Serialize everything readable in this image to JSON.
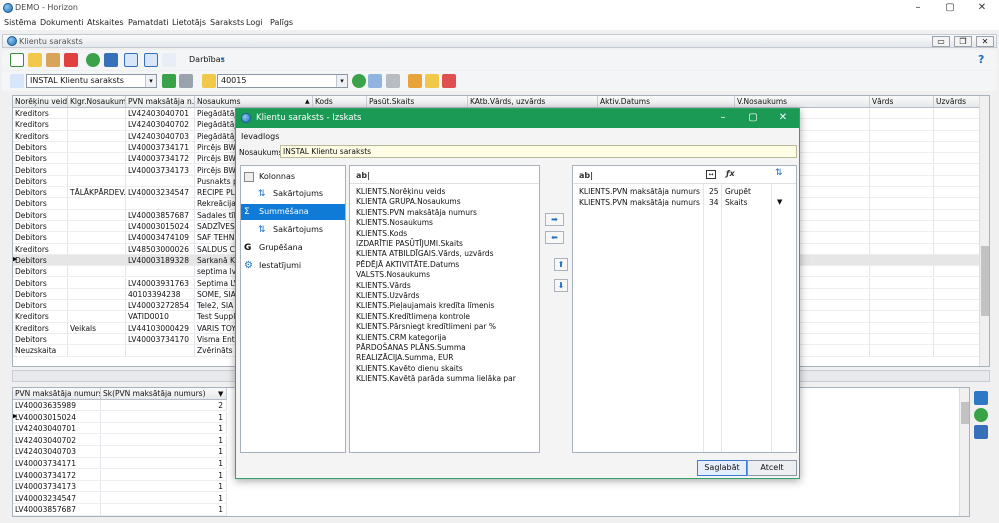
{
  "window": {
    "title": "DEMO - Horizon",
    "controls": [
      "–",
      "▢",
      "✕"
    ]
  },
  "menu": [
    "Sistēma",
    "Dokumenti",
    "Atskaites",
    "Pamatdati",
    "Lietotājs",
    "Saraksts",
    "Logi",
    "Palīgs"
  ],
  "subwindow": {
    "title": "Klientu saraksts",
    "controls": [
      "▭",
      "❐",
      "✕"
    ]
  },
  "toolbar": {
    "darbibas_label": "Darbības",
    "help": "?"
  },
  "filter": {
    "list_name": "INSTAL Klientu saraksts",
    "search_value": "40015"
  },
  "colors": {
    "dialog_title": "#1a9a54",
    "selected_nav": "#0f7bd6",
    "grid_selected": "#e6e6e6"
  },
  "grid": {
    "headers": [
      "Norēķinu veids",
      "Klgr.Nosaukums",
      "PVN maksātāja n...",
      "Nosaukums",
      "Kods",
      "Pasūt.Skaits",
      "KAtb.Vārds, uzvārds",
      "Aktiv.Datums",
      "V.Nosaukums",
      "Vārds",
      "Uzvārds"
    ],
    "rows": [
      [
        "Kreditors",
        "",
        "LV42403040701",
        "Piegādātājs B"
      ],
      [
        "Kreditors",
        "",
        "LV42403040702",
        "Piegādātājs B"
      ],
      [
        "Kreditors",
        "",
        "LV42403040703",
        "Piegādātājs B"
      ],
      [
        "Debitors",
        "",
        "LV40003734171",
        "Pircējs BW1"
      ],
      [
        "Debitors",
        "",
        "LV40003734172",
        "Pircējs BW2"
      ],
      [
        "Debitors",
        "",
        "LV40003734173",
        "Pircējs BW3"
      ],
      [
        "Debitors",
        "",
        "",
        "Pusnakts pus"
      ],
      [
        "Debitors",
        "TĀLĀKPĀRDEV...",
        "LV40003234547",
        "RECIPE PLUS"
      ],
      [
        "Debitors",
        "",
        "",
        "Rekreācijas c"
      ],
      [
        "Debitors",
        "",
        "LV40003857687",
        "Sadales tīkls,"
      ],
      [
        "Debitors",
        "",
        "LV40003015024",
        "SADZĪVES PA"
      ],
      [
        "Debitors",
        "",
        "LV40003474109",
        "SAF TEHNIKA"
      ],
      [
        "Kreditors",
        "",
        "LV48503000026",
        "SALDUS CEĻ"
      ],
      [
        "Debitors",
        "",
        "LV40003189328",
        "Sarkanā Krus"
      ],
      [
        "Debitors",
        "",
        "",
        "septima lv"
      ],
      [
        "Debitors",
        "",
        "LV40003931763",
        "Septima LV S"
      ],
      [
        "Debitors",
        "",
        "40103394238",
        "SOME, SIA"
      ],
      [
        "Debitors",
        "",
        "LV40003272854",
        "Tele2, SIA"
      ],
      [
        "Kreditors",
        "",
        "VATID0010",
        "Test Supplier"
      ],
      [
        "Kreditors",
        "Veikals",
        "LV44103000429",
        "VARIS TOYS,"
      ],
      [
        "Debitors",
        "",
        "LV40003734170",
        "Visma Enterp"
      ],
      [
        "Neuzskaita",
        "",
        "",
        "Zvērināts adv"
      ]
    ],
    "selected_row": 13
  },
  "summary": {
    "headers": [
      "PVN maksātāja numurs",
      "Sk(PVN maksātāja numurs)"
    ],
    "rows": [
      [
        "LV40003635989",
        "2"
      ],
      [
        "LV40003015024",
        "1"
      ],
      [
        "LV42403040701",
        "1"
      ],
      [
        "LV42403040702",
        "1"
      ],
      [
        "LV42403040703",
        "1"
      ],
      [
        "LV40003734171",
        "1"
      ],
      [
        "LV40003734172",
        "1"
      ],
      [
        "LV40003734173",
        "1"
      ],
      [
        "LV40003234547",
        "1"
      ],
      [
        "LV40003857687",
        "1"
      ]
    ],
    "selected_row": 1
  },
  "dialog": {
    "title": "Klientu saraksts - Izskats",
    "section": "Ievadlogs",
    "name_label": "Nosaukums:",
    "name_value": "INSTAL Klientu saraksts",
    "nav": [
      "Kolonnas",
      "Sakārtojums",
      "Summēšana",
      "Sakārtojums",
      "Grupēšana",
      "Iestatījumi"
    ],
    "nav_selected": 2,
    "available_header": "ab|",
    "available": [
      "KLIENTS.Norēķinu veids",
      "KLIENTA GRUPA.Nosaukums",
      "KLIENTS.PVN maksātāja numurs",
      "KLIENTS.Nosaukums",
      "KLIENTS.Kods",
      "IZDARĪTIE PASŪTĪJUMI.Skaits",
      "KLIENTA ATBILDĪGAIS.Vārds, uzvārds",
      "PĒDĒJĀ AKTIVITĀTE.Datums",
      "VALSTS.Nosaukums",
      "KLIENTS.Vārds",
      "KLIENTS.Uzvārds",
      "KLIENTS.Pieļaujamais kredīta līmenis",
      "KLIENTS.Kredītlimeņa kontrole",
      "KLIENTS.Pārsniegt kredītlimeni par %",
      "KLIENTS.CRM kategorija",
      "PĀRDOŠANAS PLĀNS.Summa",
      "REALIZĀCIJA.Summa, EUR",
      "KLIENTS.Kavēto dienu skaits",
      "KLIENTS.Kavētā parāda summa lielāka par"
    ],
    "selected_header": "ab|",
    "selected": [
      {
        "field": "KLIENTS.PVN maksātāja numurs",
        "width": "25",
        "func": "Grupēt"
      },
      {
        "field": "KLIENTS.PVN maksātāja numurs",
        "width": "34",
        "func": "Skaits"
      }
    ],
    "save_label": "Saglabāt",
    "cancel_label": "Atcelt"
  }
}
